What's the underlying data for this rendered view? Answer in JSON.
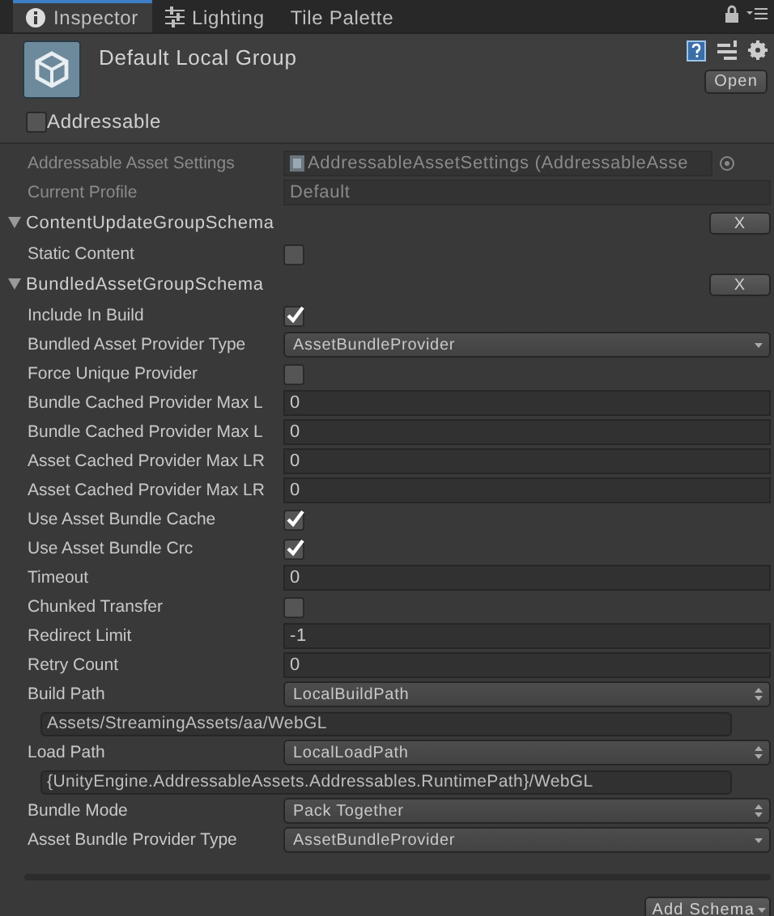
{
  "tabs": [
    {
      "label": "Inspector",
      "selected": true
    },
    {
      "label": "Lighting",
      "selected": false
    },
    {
      "label": "Tile Palette",
      "selected": false
    }
  ],
  "header": {
    "title": "Default Local Group",
    "open_button": "Open",
    "addressable": {
      "label": "Addressable",
      "checked": false
    }
  },
  "settings": [
    {
      "label": "Addressable Asset Settings",
      "kind": "object",
      "value": "AddressableAssetSettings (AddressableAsse"
    },
    {
      "label": "Current Profile",
      "kind": "text",
      "value": "Default"
    }
  ],
  "schemas": [
    {
      "title": "ContentUpdateGroupSchema",
      "expanded": true,
      "remove_button": "X",
      "fields": [
        {
          "label": "Static Content",
          "kind": "checkbox",
          "checked": false
        }
      ]
    },
    {
      "title": "BundledAssetGroupSchema",
      "expanded": true,
      "remove_button": "X",
      "fields": [
        {
          "label": "Include In Build",
          "kind": "checkbox",
          "checked": true
        },
        {
          "label": "Bundled Asset Provider Type",
          "kind": "popup",
          "value": "AssetBundleProvider"
        },
        {
          "label": "Force Unique Provider",
          "kind": "checkbox",
          "checked": false
        },
        {
          "label": "Bundle Cached Provider Max L",
          "kind": "number",
          "value": "0"
        },
        {
          "label": "Bundle Cached Provider Max L",
          "kind": "number",
          "value": "0"
        },
        {
          "label": "Asset Cached Provider Max LR",
          "kind": "number",
          "value": "0"
        },
        {
          "label": "Asset Cached Provider Max LR",
          "kind": "number",
          "value": "0"
        },
        {
          "label": "Use Asset Bundle Cache",
          "kind": "checkbox",
          "checked": true
        },
        {
          "label": "Use Asset Bundle Crc",
          "kind": "checkbox",
          "checked": true
        },
        {
          "label": "Timeout",
          "kind": "number",
          "value": "0"
        },
        {
          "label": "Chunked Transfer",
          "kind": "checkbox",
          "checked": false
        },
        {
          "label": "Redirect Limit",
          "kind": "number",
          "value": "-1"
        },
        {
          "label": "Retry Count",
          "kind": "number",
          "value": "0"
        },
        {
          "label": "Build Path",
          "kind": "enum",
          "value": "LocalBuildPath",
          "path": "Assets/StreamingAssets/aa/WebGL"
        },
        {
          "label": "Load Path",
          "kind": "enum",
          "value": "LocalLoadPath",
          "path": "{UnityEngine.AddressableAssets.Addressables.RuntimePath}/WebGL"
        },
        {
          "label": "Bundle Mode",
          "kind": "enum",
          "value": "Pack Together"
        },
        {
          "label": "Asset Bundle Provider Type",
          "kind": "popup",
          "value": "AssetBundleProvider"
        }
      ]
    }
  ],
  "add_schema_button": "Add Schema"
}
